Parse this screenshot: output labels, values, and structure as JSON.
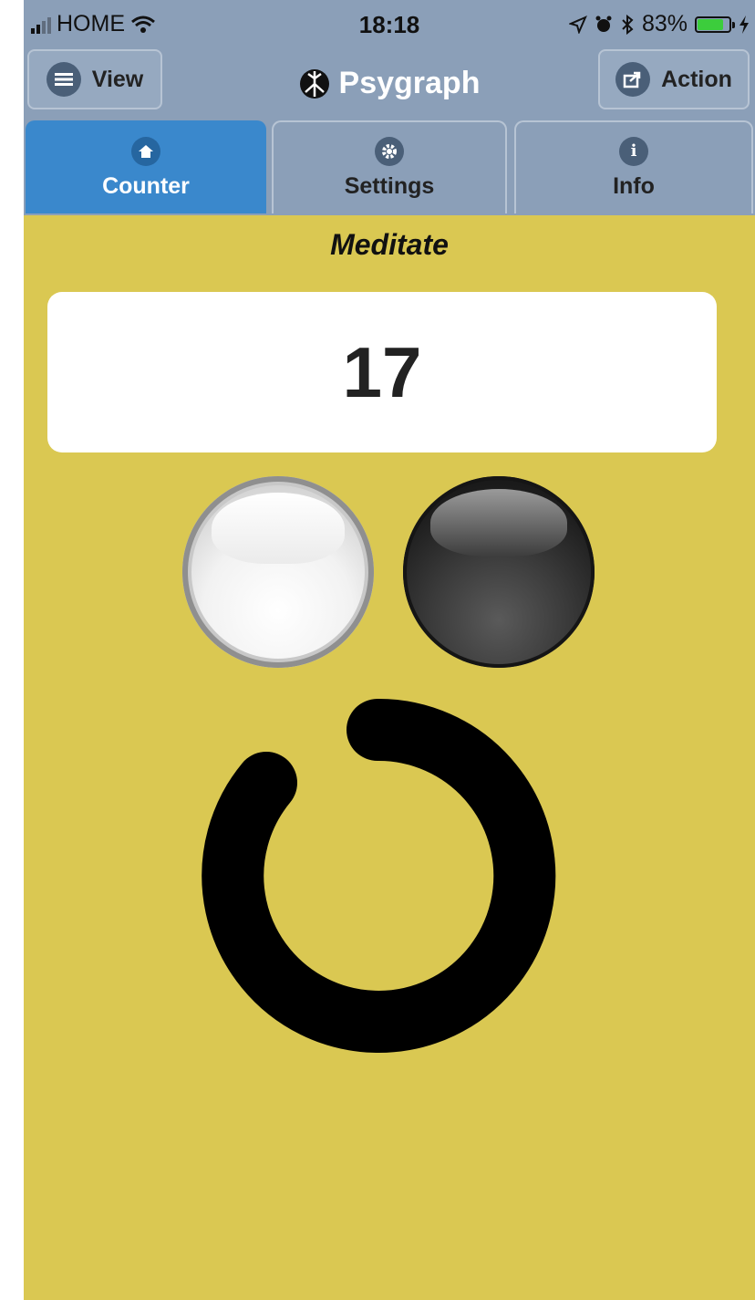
{
  "status_bar": {
    "carrier": "HOME",
    "time": "18:18",
    "battery": "83%",
    "battery_level": 0.83,
    "battery_color": "#3ccd3c"
  },
  "header": {
    "title": "Psygraph",
    "left_button": {
      "label": "View",
      "icon": "menu-icon"
    },
    "right_button": {
      "label": "Action",
      "icon": "share-icon"
    }
  },
  "tabs": [
    {
      "label": "Counter",
      "icon": "home-icon",
      "active": true
    },
    {
      "label": "Settings",
      "icon": "gear-icon",
      "active": false
    },
    {
      "label": "Info",
      "icon": "info-icon",
      "active": false
    }
  ],
  "main": {
    "mode_label": "Meditate",
    "count": "17"
  },
  "colors": {
    "background": "#dac852",
    "nav": "#8b9fb8",
    "active_tab": "#3a88cc"
  }
}
